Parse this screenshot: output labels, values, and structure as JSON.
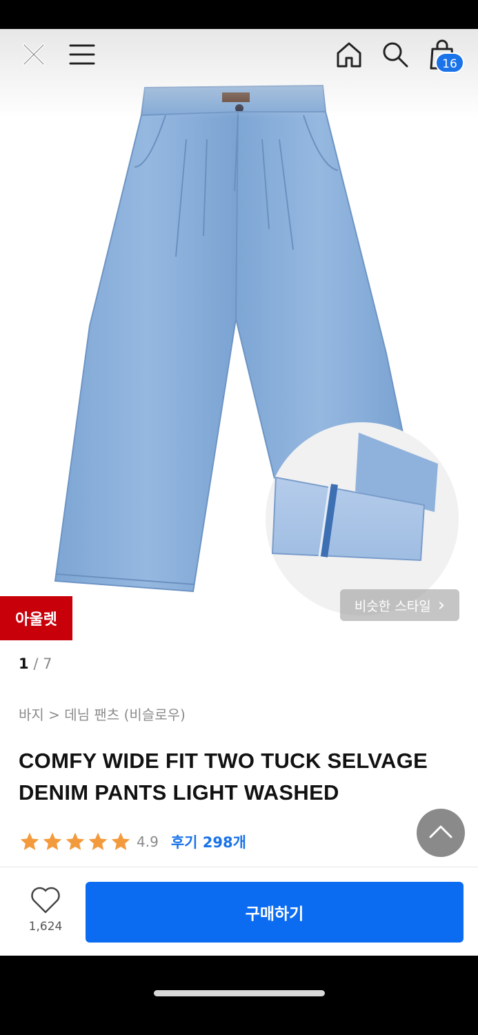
{
  "header": {
    "close_icon": "close-icon",
    "menu_icon": "hamburger-menu-icon",
    "home_icon": "home-icon",
    "search_icon": "search-icon",
    "cart_icon": "shopping-bag-icon",
    "cart_count": "16"
  },
  "hero": {
    "outlet_label": "아울렛",
    "similar_style_label": "비슷한 스타일",
    "similar_style_chevron": "›"
  },
  "gallery": {
    "current": "1",
    "separator": "/",
    "total": "7"
  },
  "product": {
    "breadcrumb": "바지 > 데님 팬츠 (비슬로우)",
    "title": "COMFY WIDE FIT TWO TUCK SELVAGE DENIM PANTS LIGHT WASHED",
    "rating_value": "4.9",
    "stars": 5,
    "review_label": "후기 298개"
  },
  "bottom": {
    "like_count": "1,624",
    "buy_label": "구매하기"
  },
  "colors": {
    "accent": "#1a73e8",
    "buy_button": "#0b6cf2",
    "outlet_tag": "#c8000a",
    "star": "#f39a3c",
    "denim": "#86acd8"
  }
}
